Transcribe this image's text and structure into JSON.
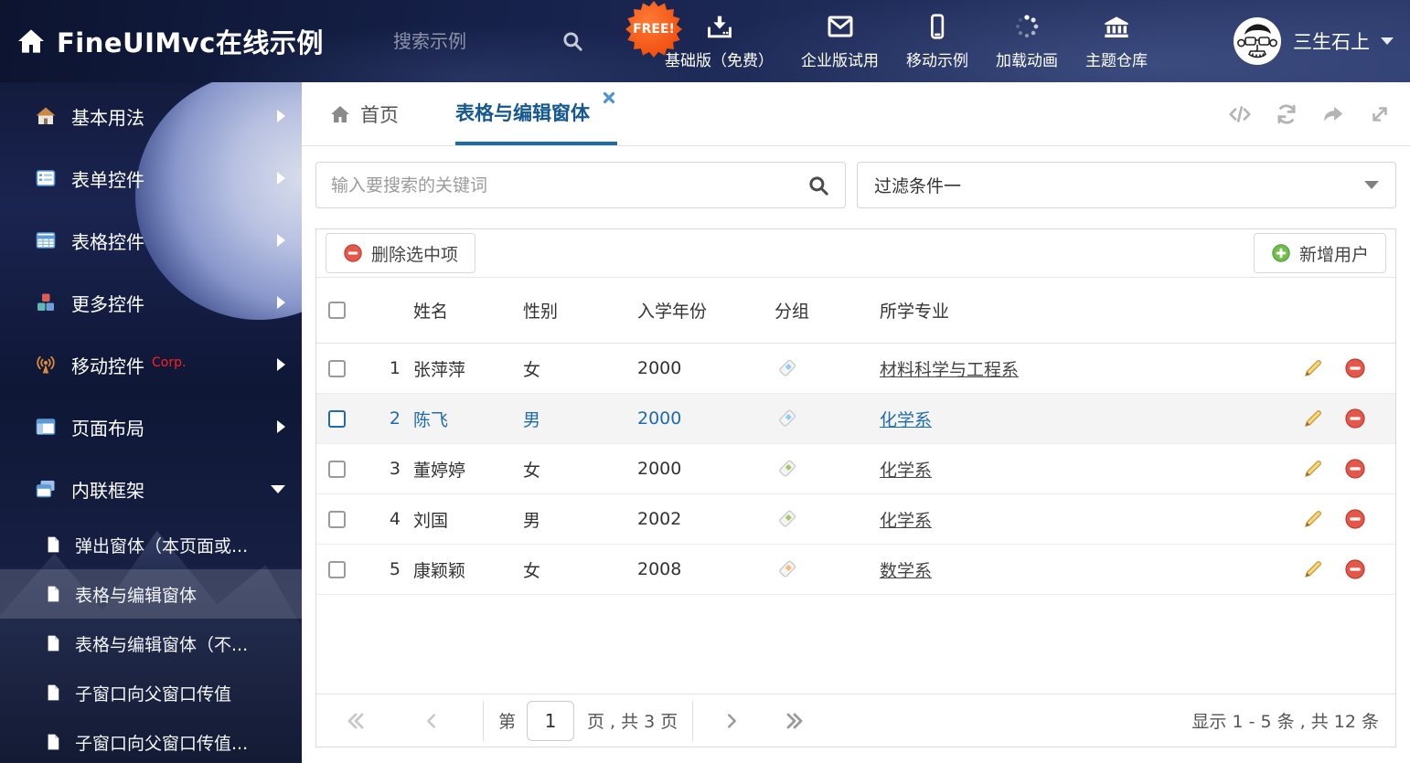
{
  "colors": {
    "accent_blue": "#1e6bb0",
    "tag_blue": "#8ecbf5",
    "tag_green": "#9ccc65",
    "tag_orange": "#ffb868",
    "free_badge_orange": "#f04e0e"
  },
  "header": {
    "logo_text": "FineUIMvc在线示例",
    "search_placeholder": "搜索示例",
    "free_badge": "FREE!",
    "nav": [
      {
        "label": "基础版（免费）"
      },
      {
        "label": "企业版试用"
      },
      {
        "label": "移动示例"
      },
      {
        "label": "加载动画"
      },
      {
        "label": "主题仓库"
      }
    ],
    "user_name": "三生石上"
  },
  "sidebar": {
    "items": [
      {
        "label": "基本用法"
      },
      {
        "label": "表单控件"
      },
      {
        "label": "表格控件"
      },
      {
        "label": "更多控件"
      },
      {
        "label": "移动控件",
        "badge": "Corp."
      },
      {
        "label": "页面布局"
      },
      {
        "label": "内联框架"
      }
    ],
    "subitems": [
      {
        "label": "弹出窗体（本页面或..."
      },
      {
        "label": "表格与编辑窗体"
      },
      {
        "label": "表格与编辑窗体（不..."
      },
      {
        "label": "子窗口向父窗口传值"
      },
      {
        "label": "子窗口向父窗口传值..."
      }
    ]
  },
  "tabs": {
    "home": "首页",
    "active": "表格与编辑窗体"
  },
  "main": {
    "search_placeholder": "输入要搜索的关键词",
    "filter_value": "过滤条件一",
    "toolbar": {
      "delete_label": "删除选中项",
      "add_label": "新增用户"
    },
    "table": {
      "columns": {
        "name": "姓名",
        "gender": "性别",
        "year": "入学年份",
        "group": "分组",
        "major": "所学专业"
      },
      "rows": [
        {
          "num": "1",
          "name": "张萍萍",
          "gender": "女",
          "year": "2000",
          "tag_color": "#8ecbf5",
          "major": "材料科学与工程系"
        },
        {
          "num": "2",
          "name": "陈飞",
          "gender": "男",
          "year": "2000",
          "tag_color": "#8ecbf5",
          "major": "化学系"
        },
        {
          "num": "3",
          "name": "董婷婷",
          "gender": "女",
          "year": "2000",
          "tag_color": "#9ccc65",
          "major": "化学系"
        },
        {
          "num": "4",
          "name": "刘国",
          "gender": "男",
          "year": "2002",
          "tag_color": "#9ccc65",
          "major": "化学系"
        },
        {
          "num": "5",
          "name": "康颖颖",
          "gender": "女",
          "year": "2008",
          "tag_color": "#ffb868",
          "major": "数学系"
        }
      ]
    },
    "pagination": {
      "page_prefix": "第",
      "current_page": "1",
      "page_suffix": "页 , 共 3 页",
      "summary": "显示 1 - 5 条 , 共 12 条"
    }
  }
}
